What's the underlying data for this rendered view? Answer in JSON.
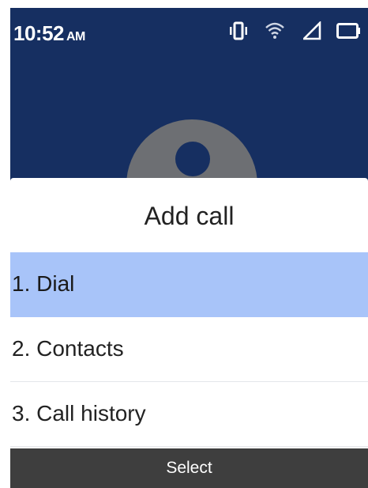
{
  "status_bar": {
    "time": "10:52",
    "ampm": "AM",
    "icons": [
      "vibrate-icon",
      "wifi-icon",
      "signal-icon",
      "battery-icon"
    ]
  },
  "background": {
    "avatar_icon": "contact-avatar-icon"
  },
  "sheet": {
    "title": "Add call",
    "items": [
      {
        "label": "1. Dial",
        "selected": true
      },
      {
        "label": "2. Contacts",
        "selected": false
      },
      {
        "label": "3. Call history",
        "selected": false
      }
    ]
  },
  "softkeys": {
    "center": "Select"
  },
  "colors": {
    "header_bg": "#162f61",
    "selected_bg": "#a8c4f9",
    "softkey_bg": "#3e3e3e"
  }
}
